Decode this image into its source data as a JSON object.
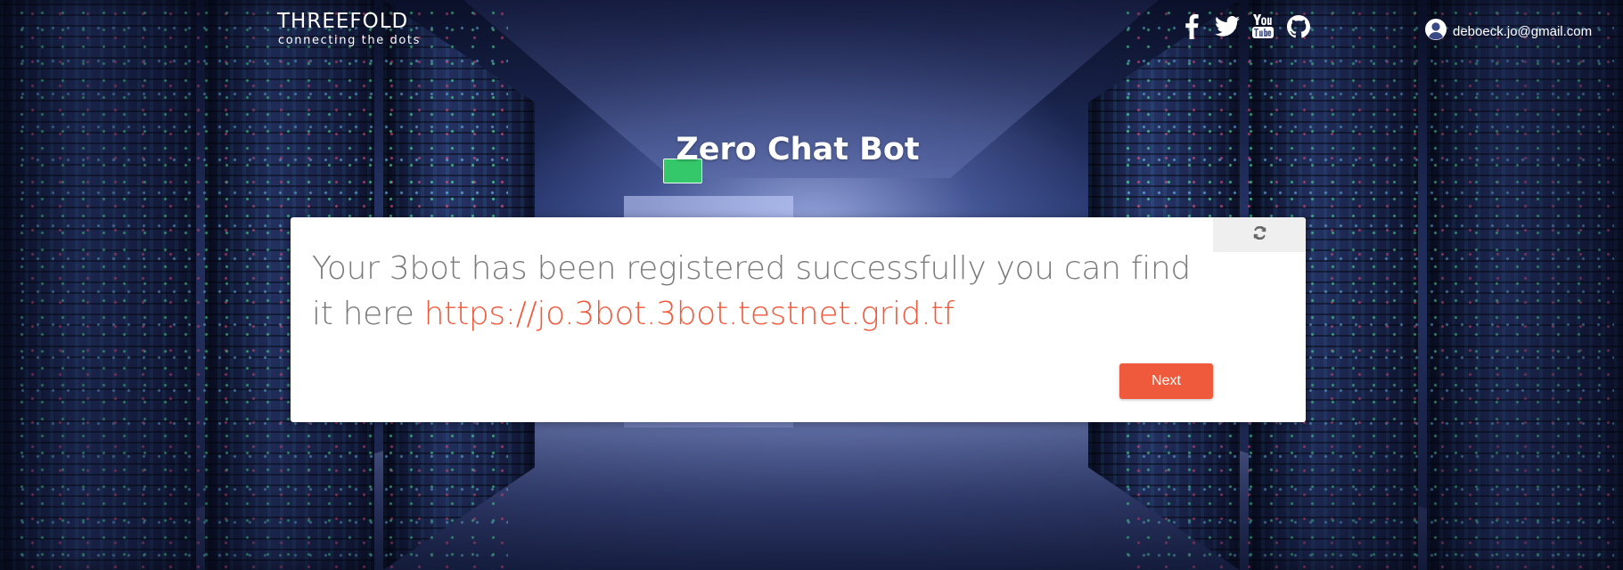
{
  "header": {
    "logo_main": "THREEFOLD",
    "logo_sub": "connecting the dots",
    "social": [
      {
        "icon": "facebook-icon"
      },
      {
        "icon": "twitter-icon"
      },
      {
        "icon": "youtube-icon"
      },
      {
        "icon": "github-icon"
      }
    ],
    "user": {
      "icon": "user-circle-icon",
      "email": "deboeck.jo@gmail.com"
    }
  },
  "main": {
    "title": "Zero Chat Bot",
    "card": {
      "refresh_icon": "refresh-icon",
      "message_text": "Your 3bot has been registered successfully you can find it here ",
      "message_link": "https://jo.3bot.3bot.testnet.grid.tf",
      "next_label": "Next"
    }
  },
  "colors": {
    "accent": "#f05a3c",
    "card_background": "#ffffff",
    "message_text": "#7b7b7b",
    "refresh_background": "#efefef"
  }
}
